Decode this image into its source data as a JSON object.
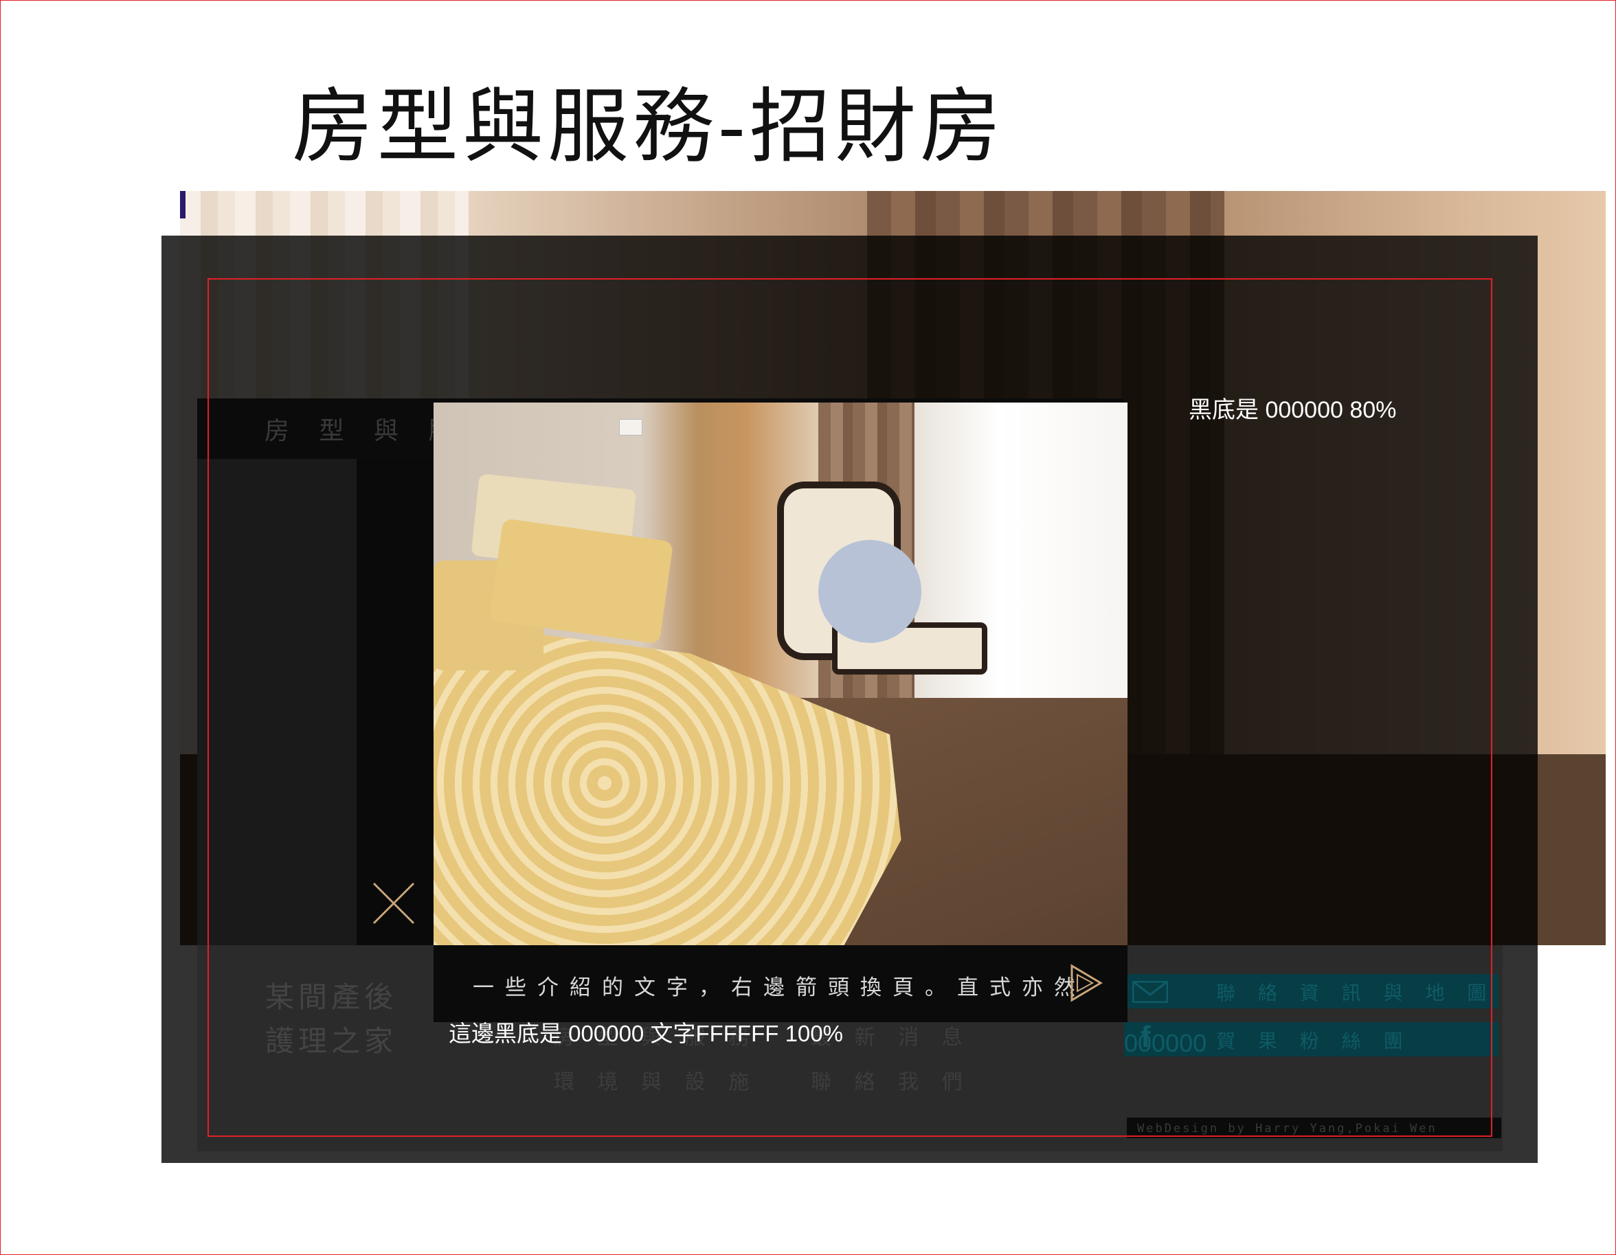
{
  "slide": {
    "title": "房型與服務-招財房"
  },
  "annotations": {
    "overlay_note": "黑底是 000000  80%",
    "caption_note": "這邊黑底是 000000 文字FFFFFF 100%"
  },
  "page": {
    "nav_text": "房 型 與 服 務",
    "brand_line1": "某間產後",
    "brand_line2": "護理之家",
    "menu": [
      "房 型 與 服 務",
      "環 境 與 設 施",
      "最 新 消 息",
      "聯 絡 我 們"
    ],
    "contact_button": "聯 絡 資 訊 與 地 圖",
    "fanpage_button": "賀 果 粉 絲 團",
    "fb_ghost_text": "000000",
    "credit": "WebDesign by Harry Yang,Pokai Wen"
  },
  "lightbox": {
    "caption": "一些介紹的文字，右邊箭頭換頁。直式亦然",
    "icons": {
      "close": "close-icon",
      "next": "play-arrow-icon",
      "mail": "mail-icon",
      "facebook": "facebook-icon"
    }
  },
  "colors": {
    "frame_red": "#e21f26",
    "overlay": "rgba(0,0,0,0.8)",
    "accent_gold": "#c9a57a",
    "button_teal": "#073d45"
  }
}
